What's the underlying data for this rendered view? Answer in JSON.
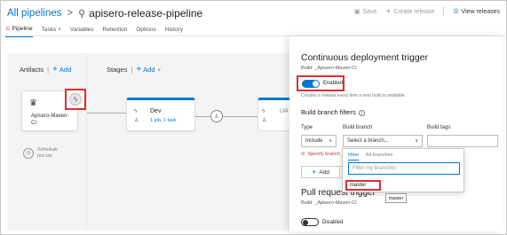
{
  "header": {
    "all_pipelines": "All pipelines",
    "separator": ">",
    "pipeline_name": "apisero-release-pipeline"
  },
  "toolbar": {
    "save": "Save",
    "create_release": "Create release",
    "view_releases": "View releases"
  },
  "tabs": [
    "Pipeline",
    "Tasks",
    "Variables",
    "Retention",
    "Options",
    "History"
  ],
  "canvas": {
    "artifacts_title": "Artifacts",
    "artifacts_add": "Add",
    "stages_title": "Stages",
    "stages_add": "Add",
    "artifact_name_line1": "Apisero-Maven-",
    "artifact_name_line2": "CI",
    "schedule_line1": "Schedule",
    "schedule_line2": "not set",
    "stage_name": "Dev",
    "stage_sub": "1 job, 1 task",
    "stage2_name": "UA"
  },
  "panel": {
    "title": "Continuous deployment trigger",
    "build_sub": "Build: _Apisero-Maven-CI",
    "enabled_label": "Enabled",
    "description": "Creates a release every time a new build is available.",
    "branch_filters_title": "Build branch filters",
    "col_type": "Type",
    "col_branch": "Build branch",
    "col_tags": "Build tags",
    "type_value": "Include",
    "branch_placeholder": "Select a branch...",
    "specify_text": "Specify branch",
    "add_label": "Add",
    "pr_title": "Pull request trigger",
    "pr_sub": "Build: _Apisero-Maven-CI",
    "disabled_label": "Disabled"
  },
  "dropdown": {
    "tab_mine": "Mine",
    "tab_all": "All branches",
    "filter_placeholder": "Filter my branches",
    "item": "master",
    "tooltip": "master"
  },
  "colors": {
    "accent": "#0078d4",
    "highlight": "#e12c2c"
  }
}
